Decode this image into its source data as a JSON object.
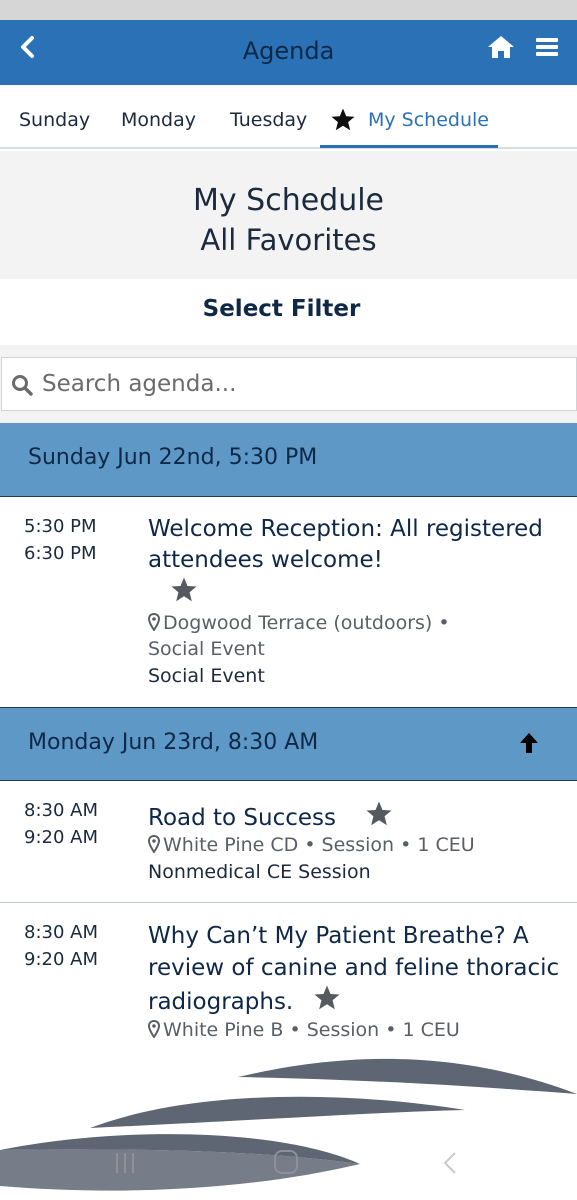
{
  "header": {
    "title": "Agenda",
    "back_icon": "chevron-left-icon",
    "home_icon": "home-icon",
    "menu_icon": "hamburger-menu-icon"
  },
  "tabs": [
    {
      "label": "Sunday"
    },
    {
      "label": "Monday"
    },
    {
      "label": "Tuesday"
    },
    {
      "label": "My Schedule",
      "icon": "star-icon",
      "active": true
    }
  ],
  "schedule": {
    "title": "My Schedule",
    "subtitle": "All Favorites"
  },
  "filter": {
    "label": "Select Filter"
  },
  "search": {
    "placeholder": "Search agenda..."
  },
  "days": [
    {
      "label": "Sunday Jun 22nd, 5:30 PM",
      "sessions": [
        {
          "start": "5:30 PM",
          "end": "6:30 PM",
          "title": "Welcome Reception: All registered attendees welcome!",
          "location": "Dogwood Terrace (outdoors) •",
          "type": "Social Event",
          "category": "Social Event"
        }
      ]
    },
    {
      "label": "Monday Jun 23rd, 8:30 AM",
      "sessions": [
        {
          "start": "8:30 AM",
          "end": "9:20 AM",
          "title": "Road to Success",
          "location": "White Pine CD • Session • 1 CEU",
          "category": "Nonmedical CE Session"
        },
        {
          "start": "8:30 AM",
          "end": "9:20 AM",
          "title": "Why Can’t My Patient Breathe? A review of canine and feline thoracic radiographs.",
          "location": "White Pine B • Session • 1 CEU"
        }
      ]
    }
  ],
  "colors": {
    "app_bar": "#2a72b5",
    "day_header": "#5d98c6",
    "text_dark": "#0f2847"
  }
}
